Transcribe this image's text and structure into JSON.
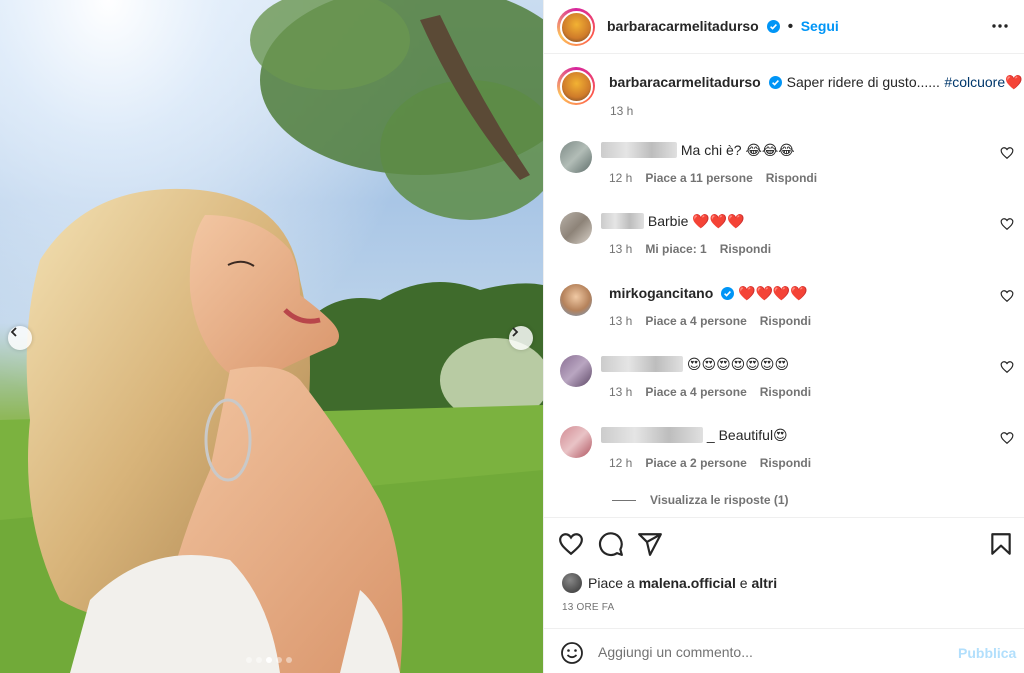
{
  "post": {
    "author": "barbaracarmelitadurso",
    "follow_label": "Segui",
    "carousel": {
      "slides": 5,
      "active_slide": 2
    }
  },
  "caption": {
    "author": "barbaracarmelitadurso",
    "text": "Saper ridere di gusto......",
    "hashtag": "#colcuore",
    "emoji": "❤️",
    "time": "13 h"
  },
  "comments": [
    {
      "author": "",
      "text": "Ma chi è? 😂😂😂",
      "time": "12 h",
      "likes": "Piace a 11 persone",
      "reply": "Rispondi"
    },
    {
      "author": "",
      "text": "Barbie ❤️❤️❤️",
      "time": "13 h",
      "likes": "Mi piace: 1",
      "reply": "Rispondi"
    },
    {
      "author": "mirkogancitano",
      "text": "❤️❤️❤️❤️",
      "time": "13 h",
      "likes": "Piace a 4 persone",
      "reply": "Rispondi"
    },
    {
      "author": "",
      "text": "😍😍😍😍😍😍😍",
      "time": "13 h",
      "likes": "Piace a 4 persone",
      "reply": "Rispondi"
    },
    {
      "author": "",
      "text": "_ Beautiful😍",
      "time": "12 h",
      "likes": "Piace a 2 persone",
      "reply": "Rispondi"
    }
  ],
  "view_replies": "Visualizza le risposte (1)",
  "liked_by": {
    "prefix": "Piace a",
    "user": "malena.official",
    "joiner": "e",
    "others": "altri"
  },
  "time_ago": "13 ORE FA",
  "add_comment": {
    "placeholder": "Aggiungi un commento...",
    "publish_label": "Pubblica"
  },
  "colors": {
    "accent": "#0095f6",
    "publish_disabled": "#b2dffc",
    "heart_red": "#c0141e",
    "hashtag": "#00376b"
  },
  "icons": [
    "chevron-left-icon",
    "chevron-right-icon",
    "verified-badge-icon",
    "more-options-icon",
    "heart-outline-icon",
    "comment-icon",
    "share-icon",
    "bookmark-icon",
    "emoji-icon"
  ]
}
